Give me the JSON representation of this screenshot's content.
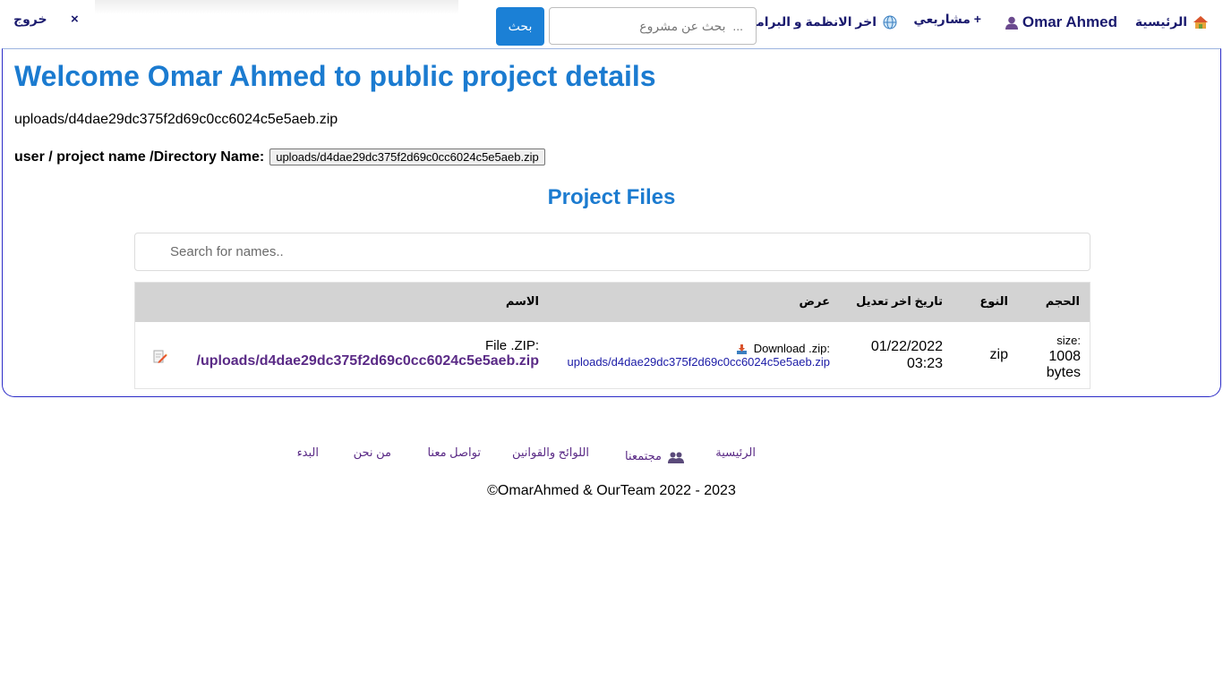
{
  "nav": {
    "home": "الرئيسية",
    "user": "Omar Ahmed",
    "projects": "مشاريعي +",
    "systems": "اخر الانظمة و البرامج",
    "search_placeholder": "...  بحث عن مشروع",
    "search_button": "بحث",
    "close": "×",
    "logout": "خروج"
  },
  "main": {
    "title": "Welcome Omar Ahmed to public project details",
    "path": "uploads/d4dae29dc375f2d69c0cc6024c5e5aeb.zip",
    "dir_label": "user / project name /Directory Name:",
    "dir_value": "uploads/d4dae29dc375f2d69c0cc6024c5e5aeb.zip",
    "files_title": "Project Files",
    "search_placeholder": "Search for names.."
  },
  "table": {
    "headers": {
      "name": "الاسم",
      "view": "عرض",
      "modified": "تاريخ اخر تعديل",
      "type": "النوع",
      "size": "الحجم"
    },
    "row": {
      "name_prefix": "File .ZIP:",
      "name_link": "/uploads/d4dae29dc375f2d69c0cc6024c5e5aeb.zip",
      "view_label": "Download .zip:",
      "view_link": "uploads/d4dae29dc375f2d69c0cc6024c5e5aeb.zip",
      "date": "01/22/2022",
      "time": "03:23",
      "type": "zip",
      "size_label": "size:",
      "size_value": "1008",
      "size_unit": "bytes"
    }
  },
  "footer": {
    "home": "الرئيسية",
    "community": "مجتمعنا",
    "rules": "اللوائح والقوانين",
    "contact": "تواصل معنا",
    "about": "من نحن",
    "start": "البدء",
    "copyright": "©OmarAhmed & OurTeam 2022 - 2023"
  },
  "colors": {
    "accent": "#1b7bd0",
    "nav_text": "#1a1a6e",
    "link_purple": "#5a2a86",
    "border": "#2b2bc7"
  },
  "icons": [
    "house-icon",
    "user-icon",
    "globe-icon",
    "edit-file-icon",
    "download-icon",
    "group-icon",
    "close-icon"
  ]
}
